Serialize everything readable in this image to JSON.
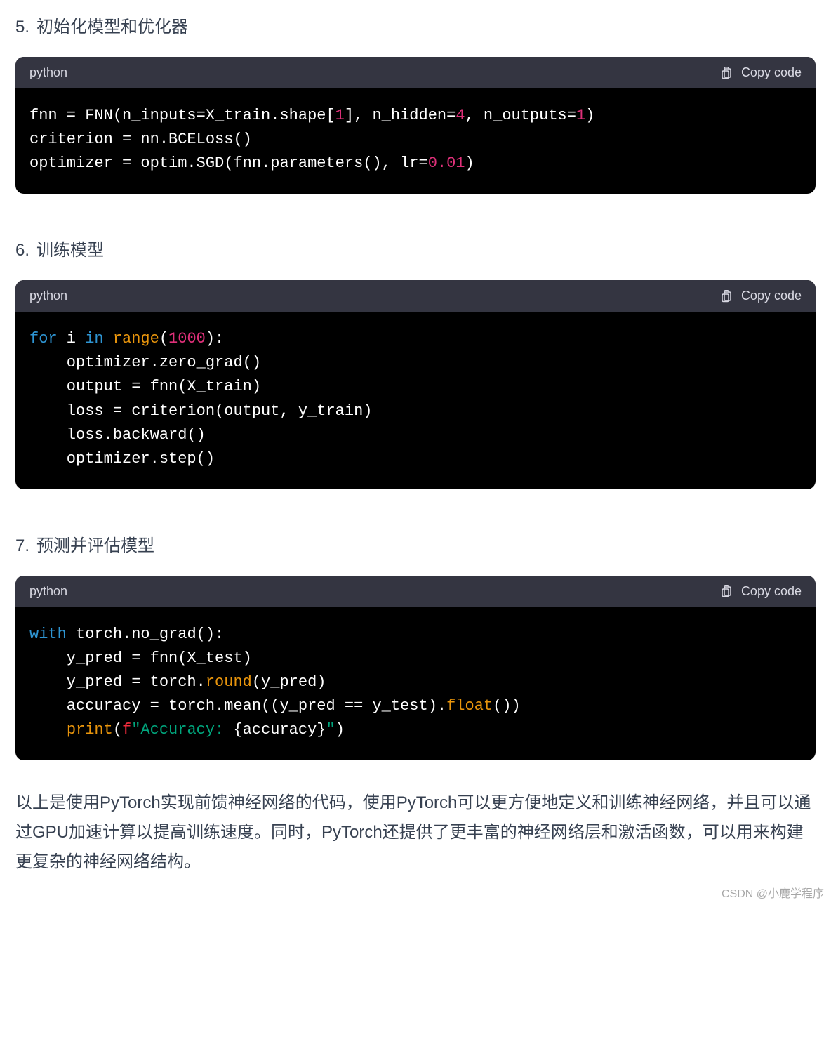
{
  "sections": [
    {
      "number": "5.",
      "title": "初始化模型和优化器"
    },
    {
      "number": "6.",
      "title": "训练模型"
    },
    {
      "number": "7.",
      "title": "预测并评估模型"
    }
  ],
  "code_ui": {
    "language_label": "python",
    "copy_label": "Copy code"
  },
  "code_blocks": {
    "block1": {
      "tokens": [
        [
          "",
          "fnn = FNN(n_inputs=X_train.shape["
        ],
        [
          "num",
          "1"
        ],
        [
          "",
          "], n_hidden="
        ],
        [
          "num",
          "4"
        ],
        [
          "",
          ", n_outputs="
        ],
        [
          "num",
          "1"
        ],
        [
          "",
          ")\ncriterion = nn.BCELoss()\noptimizer = optim.SGD(fnn.parameters(), lr="
        ],
        [
          "num",
          "0.01"
        ],
        [
          "",
          ")"
        ]
      ]
    },
    "block2": {
      "tokens": [
        [
          "keyword",
          "for"
        ],
        [
          "",
          " i "
        ],
        [
          "keyword",
          "in"
        ],
        [
          "",
          " "
        ],
        [
          "builtin",
          "range"
        ],
        [
          "",
          "("
        ],
        [
          "num",
          "1000"
        ],
        [
          "",
          "):\n    optimizer.zero_grad()\n    output = fnn(X_train)\n    loss = criterion(output, y_train)\n    loss.backward()\n    optimizer.step()"
        ]
      ]
    },
    "block3": {
      "tokens": [
        [
          "keyword",
          "with"
        ],
        [
          "",
          " torch.no_grad():\n    y_pred = fnn(X_test)\n    y_pred = torch."
        ],
        [
          "builtin",
          "round"
        ],
        [
          "",
          "(y_pred)\n    accuracy = torch.mean((y_pred == y_test)."
        ],
        [
          "builtin",
          "float"
        ],
        [
          "",
          "())\n    "
        ],
        [
          "builtin",
          "print"
        ],
        [
          "",
          "("
        ],
        [
          "call",
          "f"
        ],
        [
          "string",
          "\"Accuracy: "
        ],
        [
          "fstring-inner",
          "{accuracy}"
        ],
        [
          "string",
          "\""
        ],
        [
          "",
          ")"
        ]
      ]
    }
  },
  "closing_paragraph": "以上是使用PyTorch实现前馈神经网络的代码，使用PyTorch可以更方便地定义和训练神经网络，并且可以通过GPU加速计算以提高训练速度。同时，PyTorch还提供了更丰富的神经网络层和激活函数，可以用来构建更复杂的神经网络结构。",
  "watermark": "CSDN @小鹿学程序"
}
